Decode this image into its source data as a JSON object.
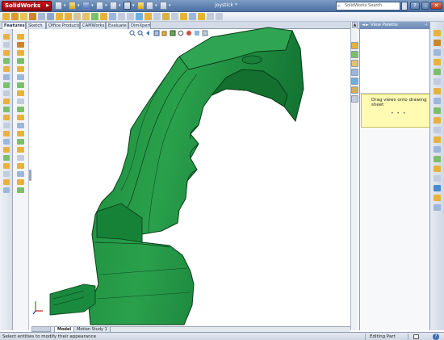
{
  "app": {
    "logo_text": "SolidWorks",
    "document_title": "joystick *",
    "search_placeholder": "SolidWorks Search"
  },
  "command_tabs": [
    "Features",
    "Sketch",
    "Office Products",
    "CAMWorks",
    "Evaluate",
    "DimXpert"
  ],
  "active_tab": "Features",
  "view_palette": {
    "title": "View Palette",
    "tooltip": "Drag views onto drawing sheet",
    "dots": "• • •"
  },
  "bottom_tabs": [
    "Model",
    "Motion Study 1"
  ],
  "active_bottom_tab": "Model",
  "status": {
    "message": "Select entities to modify their appearance",
    "mode": "Editing Part"
  },
  "colors": {
    "model_green": "#1e8a3f",
    "model_edge": "#073d18",
    "title_blue": "#5f82b0",
    "tooltip_yellow": "#fffbb3"
  },
  "icons": {
    "search": "search-icon",
    "help": "help-icon",
    "close": "close-icon",
    "minimize": "minimize-icon"
  }
}
